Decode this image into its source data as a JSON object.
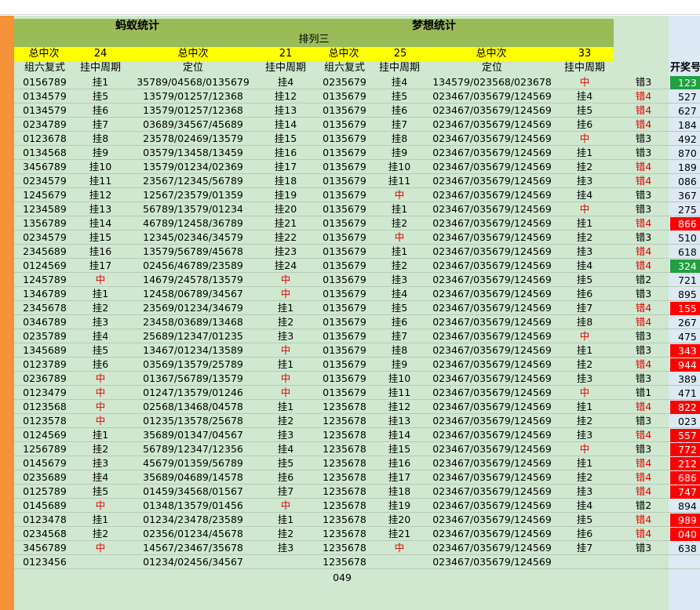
{
  "titles": {
    "left": "蚂蚁统计",
    "right": "梦想统计",
    "subtitle": "排列三"
  },
  "summary": {
    "a_label": "总中次",
    "a_value": "24",
    "b_label": "总中次",
    "b_value": "21",
    "c_label": "总中次",
    "c_value": "25",
    "d_label": "总中次",
    "d_value": "33"
  },
  "columns": [
    "组六复式",
    "挂中周期",
    "定位",
    "挂中周期",
    "组六复式",
    "挂中周期",
    "定位",
    "挂中周期"
  ],
  "result_header": "开奖号",
  "rows": [
    [
      "0156789",
      "挂1",
      "35789/04568/0135679",
      "挂4",
      "0235679",
      "挂4",
      "134579/023568/023678",
      "中",
      "错3",
      "123"
    ],
    [
      "0134579",
      "挂5",
      "13579/01257/12368",
      "挂12",
      "0135679",
      "挂5",
      "023467/035679/124569",
      "挂4",
      "错4",
      "527"
    ],
    [
      "0134579",
      "挂6",
      "13579/01257/12368",
      "挂13",
      "0135679",
      "挂6",
      "023467/035679/124569",
      "挂5",
      "错4",
      "627"
    ],
    [
      "0234789",
      "挂7",
      "03689/34567/45689",
      "挂14",
      "0135679",
      "挂7",
      "023467/035679/124569",
      "挂6",
      "错4",
      "184"
    ],
    [
      "0123678",
      "挂8",
      "23578/02469/13579",
      "挂15",
      "0135679",
      "挂8",
      "023467/035679/124569",
      "中",
      "错3",
      "492"
    ],
    [
      "0134568",
      "挂9",
      "03579/13458/13459",
      "挂16",
      "0135679",
      "挂9",
      "023467/035679/124569",
      "挂1",
      "错3",
      "870"
    ],
    [
      "3456789",
      "挂10",
      "13579/01234/02369",
      "挂17",
      "0135679",
      "挂10",
      "023467/035679/124569",
      "挂2",
      "错4",
      "189"
    ],
    [
      "0234579",
      "挂11",
      "23567/12345/56789",
      "挂18",
      "0135679",
      "挂11",
      "023467/035679/124569",
      "挂3",
      "错4",
      "086"
    ],
    [
      "1245679",
      "挂12",
      "12567/23579/01359",
      "挂19",
      "0135679",
      "中",
      "023467/035679/124569",
      "挂4",
      "错3",
      "367"
    ],
    [
      "1234589",
      "挂13",
      "56789/13579/01234",
      "挂20",
      "0135679",
      "挂1",
      "023467/035679/124569",
      "中",
      "错3",
      "275"
    ],
    [
      "1356789",
      "挂14",
      "46789/12458/36789",
      "挂21",
      "0135679",
      "挂2",
      "023467/035679/124569",
      "挂1",
      "错4",
      "866"
    ],
    [
      "0234579",
      "挂15",
      "12345/02346/34579",
      "挂22",
      "0135679",
      "中",
      "023467/035679/124569",
      "挂2",
      "错3",
      "510"
    ],
    [
      "2345689",
      "挂16",
      "13579/56789/45678",
      "挂23",
      "0135679",
      "挂1",
      "023467/035679/124569",
      "挂3",
      "错4",
      "618"
    ],
    [
      "0124569",
      "挂17",
      "02456/46789/23589",
      "挂24",
      "0135679",
      "挂2",
      "023467/035679/124569",
      "挂4",
      "错4",
      "324"
    ],
    [
      "1245789",
      "中",
      "14679/24578/13579",
      "中",
      "0135679",
      "挂3",
      "023467/035679/124569",
      "挂5",
      "错2",
      "721"
    ],
    [
      "1346789",
      "挂1",
      "12458/06789/34567",
      "中",
      "0135679",
      "挂4",
      "023467/035679/124569",
      "挂6",
      "错3",
      "895"
    ],
    [
      "2345678",
      "挂2",
      "23569/01234/34679",
      "挂1",
      "0135679",
      "挂5",
      "023467/035679/124569",
      "挂7",
      "错4",
      "155"
    ],
    [
      "0346789",
      "挂3",
      "23458/03689/13468",
      "挂2",
      "0135679",
      "挂6",
      "023467/035679/124569",
      "挂8",
      "错4",
      "267"
    ],
    [
      "0235789",
      "挂4",
      "25689/12347/01235",
      "挂3",
      "0135679",
      "挂7",
      "023467/035679/124569",
      "中",
      "错3",
      "475"
    ],
    [
      "1345689",
      "挂5",
      "13467/01234/13589",
      "中",
      "0135679",
      "挂8",
      "023467/035679/124569",
      "挂1",
      "错3",
      "343"
    ],
    [
      "0123789",
      "挂6",
      "03569/13579/25789",
      "挂1",
      "0135679",
      "挂9",
      "023467/035679/124569",
      "挂2",
      "错4",
      "944"
    ],
    [
      "0236789",
      "中",
      "01367/56789/13579",
      "中",
      "0135679",
      "挂10",
      "023467/035679/124569",
      "挂3",
      "错3",
      "389"
    ],
    [
      "0123479",
      "中",
      "01247/13579/01246",
      "中",
      "0135679",
      "挂11",
      "023467/035679/124569",
      "中",
      "错1",
      "471"
    ],
    [
      "0123568",
      "中",
      "02568/13468/04578",
      "挂1",
      "1235678",
      "挂12",
      "023467/035679/124569",
      "挂1",
      "错4",
      "822"
    ],
    [
      "0123578",
      "中",
      "01235/13578/25678",
      "挂2",
      "1235678",
      "挂13",
      "023467/035679/124569",
      "挂2",
      "错3",
      "023"
    ],
    [
      "0124569",
      "挂1",
      "35689/01347/04567",
      "挂3",
      "1235678",
      "挂14",
      "023467/035679/124569",
      "挂3",
      "错4",
      "557"
    ],
    [
      "1256789",
      "挂2",
      "56789/12347/12356",
      "挂4",
      "1235678",
      "挂15",
      "023467/035679/124569",
      "中",
      "错3",
      "772"
    ],
    [
      "0145679",
      "挂3",
      "45679/01359/56789",
      "挂5",
      "1235678",
      "挂16",
      "023467/035679/124569",
      "挂1",
      "错4",
      "212"
    ],
    [
      "0235689",
      "挂4",
      "35689/04689/14578",
      "挂6",
      "1235678",
      "挂17",
      "023467/035679/124569",
      "挂2",
      "错4",
      "686"
    ],
    [
      "0125789",
      "挂5",
      "01459/34568/01567",
      "挂7",
      "1235678",
      "挂18",
      "023467/035679/124569",
      "挂3",
      "错4",
      "747"
    ],
    [
      "0145689",
      "中",
      "01348/13579/01456",
      "中",
      "1235678",
      "挂19",
      "023467/035679/124569",
      "挂4",
      "错2",
      "894"
    ],
    [
      "0123478",
      "挂1",
      "01234/23478/23589",
      "挂1",
      "1235678",
      "挂20",
      "023467/035679/124569",
      "挂5",
      "错4",
      "989"
    ],
    [
      "0234568",
      "挂2",
      "02356/01234/45678",
      "挂2",
      "1235678",
      "挂21",
      "023467/035679/124569",
      "挂6",
      "错4",
      "040"
    ],
    [
      "3456789",
      "中",
      "14567/23467/35678",
      "挂3",
      "1235678",
      "中",
      "023467/035679/124569",
      "挂7",
      "错3",
      "638"
    ],
    [
      "0123456",
      "",
      "01234/02456/34567",
      "",
      "1235678",
      "",
      "023467/035679/124569",
      "",
      "",
      ""
    ]
  ],
  "result_styles": {
    "green": [
      "123",
      "324"
    ],
    "red": [
      "866",
      "155",
      "343",
      "944",
      "822",
      "557",
      "772",
      "212",
      "686",
      "747",
      "989",
      "040"
    ]
  },
  "footer": "049",
  "colors": {
    "sheet_bg": "#cfe8cf",
    "header_green": "#9bbb59",
    "yellow": "#ffff00",
    "red": "#e00000",
    "orange": "#f4933a"
  }
}
